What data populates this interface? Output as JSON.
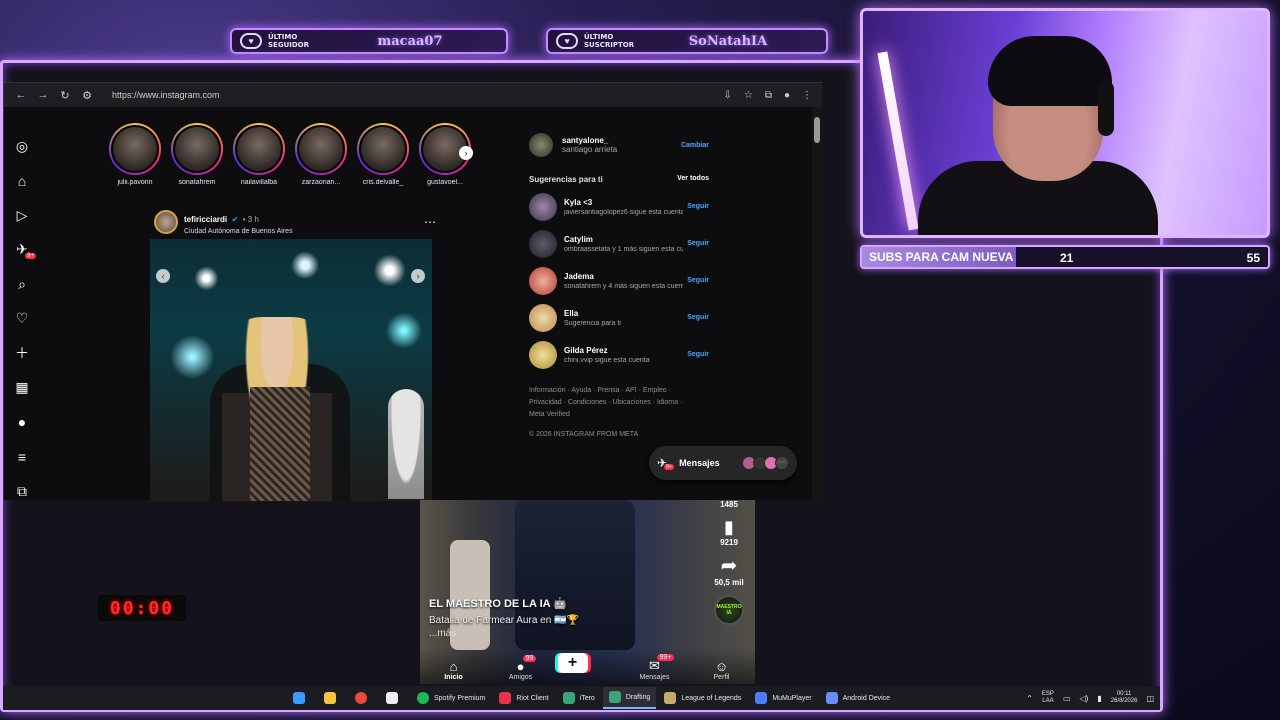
{
  "overlay": {
    "last_follower": {
      "caption": "ÚLTIMO SEGUIDOR",
      "name": "macaa07"
    },
    "last_subscriber": {
      "caption": "ÚLTIMO SUSCRIPTOR",
      "name": "SoNatahIA"
    },
    "goal": {
      "label": "SUBS PARA CAM NUEVA",
      "current": "21",
      "target": "55",
      "progress": 0.38
    },
    "timer": "00:00",
    "accent": "#c48bff"
  },
  "browser": {
    "url": "https://www.instagram.com"
  },
  "instagram": {
    "stories": [
      {
        "name": "julii.pavonn"
      },
      {
        "name": "sonatahrem"
      },
      {
        "name": "nailavillalba"
      },
      {
        "name": "zarzaorian..."
      },
      {
        "name": "cris.delvalle_"
      },
      {
        "name": "gustavoel..."
      }
    ],
    "post": {
      "user": "tefiricciardi",
      "time": "• 3 h",
      "location": "Ciudad Autónoma de Buenos Aires"
    },
    "account": {
      "username": "santyalone_",
      "name": "santiago arrieta",
      "action": "Cambiar"
    },
    "suggestions_title": "Sugerencias para ti",
    "see_all": "Ver todos",
    "suggestions": [
      {
        "user": "Kyla <3",
        "sub": "javiersantiagolopez6 sigue esta cuenta",
        "action": "Seguir"
      },
      {
        "user": "Catylim",
        "sub": "ombraassetata y 1 más siguen esta cuenta",
        "action": "Seguir"
      },
      {
        "user": "Jadema",
        "sub": "sonatahrem y 4 más siguen esta cuenta",
        "action": "Seguir"
      },
      {
        "user": "Ella",
        "sub": "Sugerencia para ti",
        "action": "Seguir"
      },
      {
        "user": "Gilda Pérez",
        "sub": "chini.vvip sigue esta cuenta",
        "action": "Seguir"
      }
    ],
    "footer_links": "Información · Ayuda · Prensa · API · Empleo · Privacidad · Condiciones · Ubicaciones · Idioma · Meta Verified",
    "copyright": "© 2026 INSTAGRAM FROM META",
    "messages_label": "Mensajes",
    "messages_badge": "9+",
    "notif_badge": "9+"
  },
  "tiktok": {
    "likes": "1485",
    "saves": "9219",
    "shares": "50,5 mil",
    "channel": "EL MAESTRO DE LA IA 🤖",
    "description": "Batalla de Farmear Aura en 🇦🇷🏆",
    "more": "...más",
    "disc_label": "MAESTRO IA",
    "tabs": [
      {
        "label": "Inicio",
        "icon": "⌂"
      },
      {
        "label": "Amigos",
        "badge": "99"
      },
      {
        "label": "Mensajes",
        "badge": "99+"
      },
      {
        "label": "Perfil",
        "icon": "👤"
      }
    ]
  },
  "taskbar": {
    "apps": [
      {
        "label": "Spotify Premium",
        "color": "#1db954"
      },
      {
        "label": "Riot Client",
        "color": "#e8334a"
      },
      {
        "label": "iTero",
        "color": "#3aa57a"
      },
      {
        "label": "Drafting",
        "color": "#3aa57a",
        "active": true
      },
      {
        "label": "League of Legends",
        "color": "#c8aa6e"
      },
      {
        "label": "MuMuPlayer",
        "color": "#4a7dff"
      },
      {
        "label": "Android Device",
        "color": "#6c8cff"
      }
    ],
    "lang_top": "ESP",
    "lang_bottom": "LAA",
    "time": "00:11",
    "date": "26/8/2026"
  }
}
